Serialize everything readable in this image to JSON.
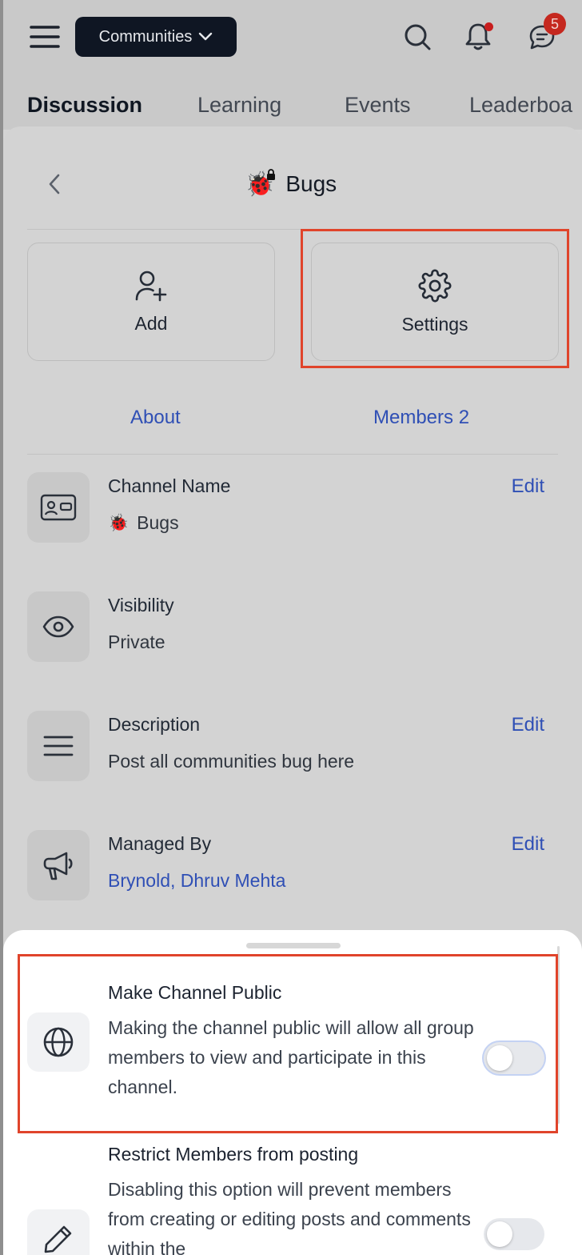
{
  "topbar": {
    "communities_label": "Communities",
    "message_badge_count": "5",
    "icons": [
      "hamburger-menu-icon",
      "search-icon",
      "bell-icon",
      "chat-icon"
    ]
  },
  "tabs": [
    {
      "label": "Discussion",
      "active": true
    },
    {
      "label": "Learning",
      "active": false
    },
    {
      "label": "Events",
      "active": false
    },
    {
      "label": "Leaderboa",
      "active": false
    }
  ],
  "channel": {
    "emoji": "🐞",
    "title": "Bugs"
  },
  "actions": {
    "add_label": "Add",
    "settings_label": "Settings"
  },
  "subtabs": {
    "about": "About",
    "members": "Members 2"
  },
  "details": [
    {
      "label": "Channel Name",
      "value": "Bugs",
      "edit": "Edit",
      "icon": "id-card-icon"
    },
    {
      "label": "Visibility",
      "value": "Private",
      "edit": "",
      "icon": "eye-icon"
    },
    {
      "label": "Description",
      "value": "Post all communities bug here",
      "edit": "Edit",
      "icon": "lines-icon"
    },
    {
      "label": "Managed By",
      "value": "Brynold, Dhruv Mehta",
      "edit": "Edit",
      "icon": "megaphone-icon"
    }
  ],
  "settings": [
    {
      "title": "Make Channel Public",
      "description": "Making the channel public will allow all group members to view and participate in this channel.",
      "enabled": false,
      "icon": "globe-icon"
    },
    {
      "title": "Restrict Members from posting",
      "description": "Disabling this option will prevent members from creating or editing posts and comments within the",
      "enabled": false,
      "icon": "pencil-icon"
    }
  ],
  "colors": {
    "accent_blue": "#2f4fb5",
    "highlight_red": "#e0442b",
    "badge_red": "#c5281f",
    "dark_button": "#0f1623"
  }
}
